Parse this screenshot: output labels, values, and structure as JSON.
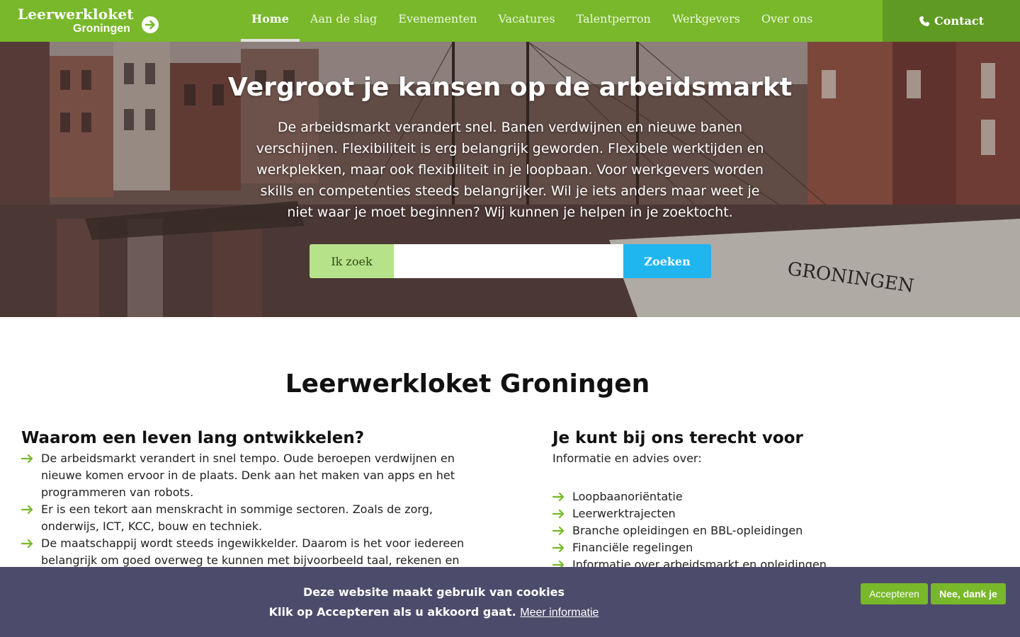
{
  "header": {
    "logo_title": "Leerwerkloket",
    "logo_subtitle": "Groningen",
    "nav": [
      {
        "label": "Home",
        "active": true
      },
      {
        "label": "Aan de slag"
      },
      {
        "label": "Evenementen"
      },
      {
        "label": "Vacatures"
      },
      {
        "label": "Talentperron"
      },
      {
        "label": "Werkgevers"
      },
      {
        "label": "Over ons"
      }
    ],
    "contact_label": "Contact"
  },
  "hero": {
    "title": "Vergroot je kansen op de arbeidsmarkt",
    "text": "De arbeidsmarkt verandert snel. Banen verdwijnen en nieuwe banen verschijnen. Flexibiliteit is erg belangrijk geworden. Flexibele werktijden en werkplekken, maar ook flexibiliteit in je loopbaan. Voor werkgevers worden skills en competenties steeds belangrijker. Wil je iets anders maar weet je niet waar je moet beginnen? Wij kunnen je helpen in je zoektocht.",
    "search": {
      "label": "Ik zoek",
      "value": "",
      "button": "Zoeken"
    }
  },
  "main": {
    "title": "Leerwerkloket Groningen",
    "left": {
      "title": "Waarom een leven lang ontwikkelen?",
      "items": [
        "De arbeidsmarkt verandert in snel tempo. Oude beroepen verdwijnen en nieuwe komen ervoor in de plaats. Denk aan het maken van apps en het programmeren van robots.",
        "Er is een tekort aan menskracht in sommige sectoren. Zoals de zorg, onderwijs, ICT, KCC, bouw en techniek.",
        "De maatschappij wordt steeds ingewikkelder. Daarom is het voor iedereen belangrijk om goed overweg te kunnen met bijvoorbeeld taal, rekenen en"
      ]
    },
    "right": {
      "title": "Je kunt bij ons terecht voor",
      "intro": "Informatie en advies over:",
      "items": [
        "Loopbaanoriëntatie",
        "Leerwerktrajecten",
        "Branche opleidingen en BBL-opleidingen",
        "Financiële regelingen",
        "Informatie over arbeidsmarkt en opleidingen"
      ]
    }
  },
  "cookie": {
    "line1": "Deze website maakt gebruik van cookies",
    "line2": "Klik op Accepteren als u akkoord gaat.",
    "link": "Meer informatie",
    "accept": "Accepteren",
    "decline": "Nee, dank je"
  },
  "colors": {
    "brand_green": "#78b82a",
    "contact_green": "#5f9a22",
    "search_blue": "#1fb6f0",
    "cookie_bg": "#4d4b6b"
  }
}
